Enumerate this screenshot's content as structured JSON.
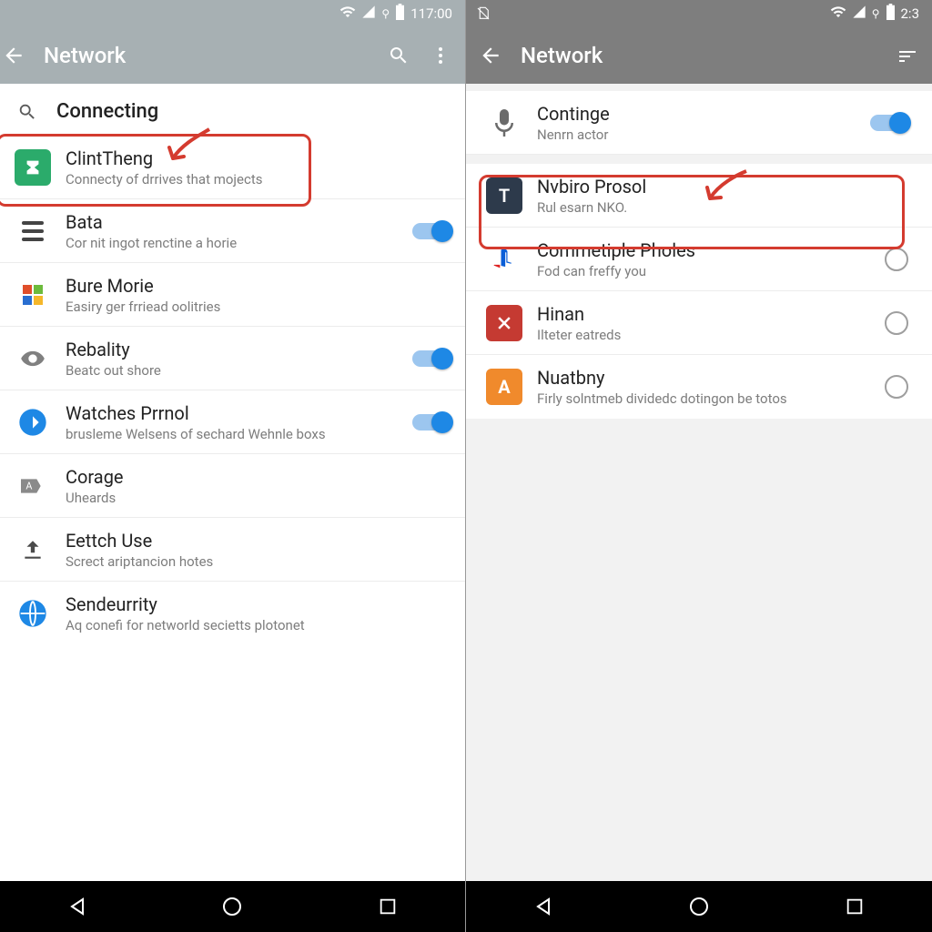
{
  "left": {
    "status": {
      "time": "117:00"
    },
    "toolbar": {
      "title": "Network"
    },
    "section_header": "Connecting",
    "items": [
      {
        "title": "ClintTheng",
        "sub": "Connecty of drrives that mojects"
      },
      {
        "title": "Bata",
        "sub": "Cor nit ingot renctine a horie"
      },
      {
        "title": "Bure Morie",
        "sub": "Easiry ger frriead oolitries"
      },
      {
        "title": "Rebality",
        "sub": "Beatc out shore"
      },
      {
        "title": "Watches Prrnol",
        "sub": "brusleme Welsens of sechard Wehnle boxs"
      },
      {
        "title": "Corage",
        "sub": "Uheards"
      },
      {
        "title": "Eettch Use",
        "sub": "Screct ariptancion hotes"
      },
      {
        "title": "Sendeurrity",
        "sub": "Aq conefi for networld secietts plotonet"
      }
    ]
  },
  "right": {
    "status": {
      "time": "2:3"
    },
    "toolbar": {
      "title": "Network"
    },
    "items": [
      {
        "title": "Continge",
        "sub": "Nenrn actor"
      },
      {
        "title": "Nvbiro Prosol",
        "sub": "Rul esarn NKO."
      },
      {
        "title": "Commetiple Pholes",
        "sub": "Fod can freffy you"
      },
      {
        "title": "Hinan",
        "sub": "Ilteter eatreds"
      },
      {
        "title": "Nuatbny",
        "sub": "Firly solntmeb dividedc dotingon be totos"
      }
    ]
  },
  "colors": {
    "highlight": "#d43b2f",
    "switch_on": "#1e88e5"
  }
}
